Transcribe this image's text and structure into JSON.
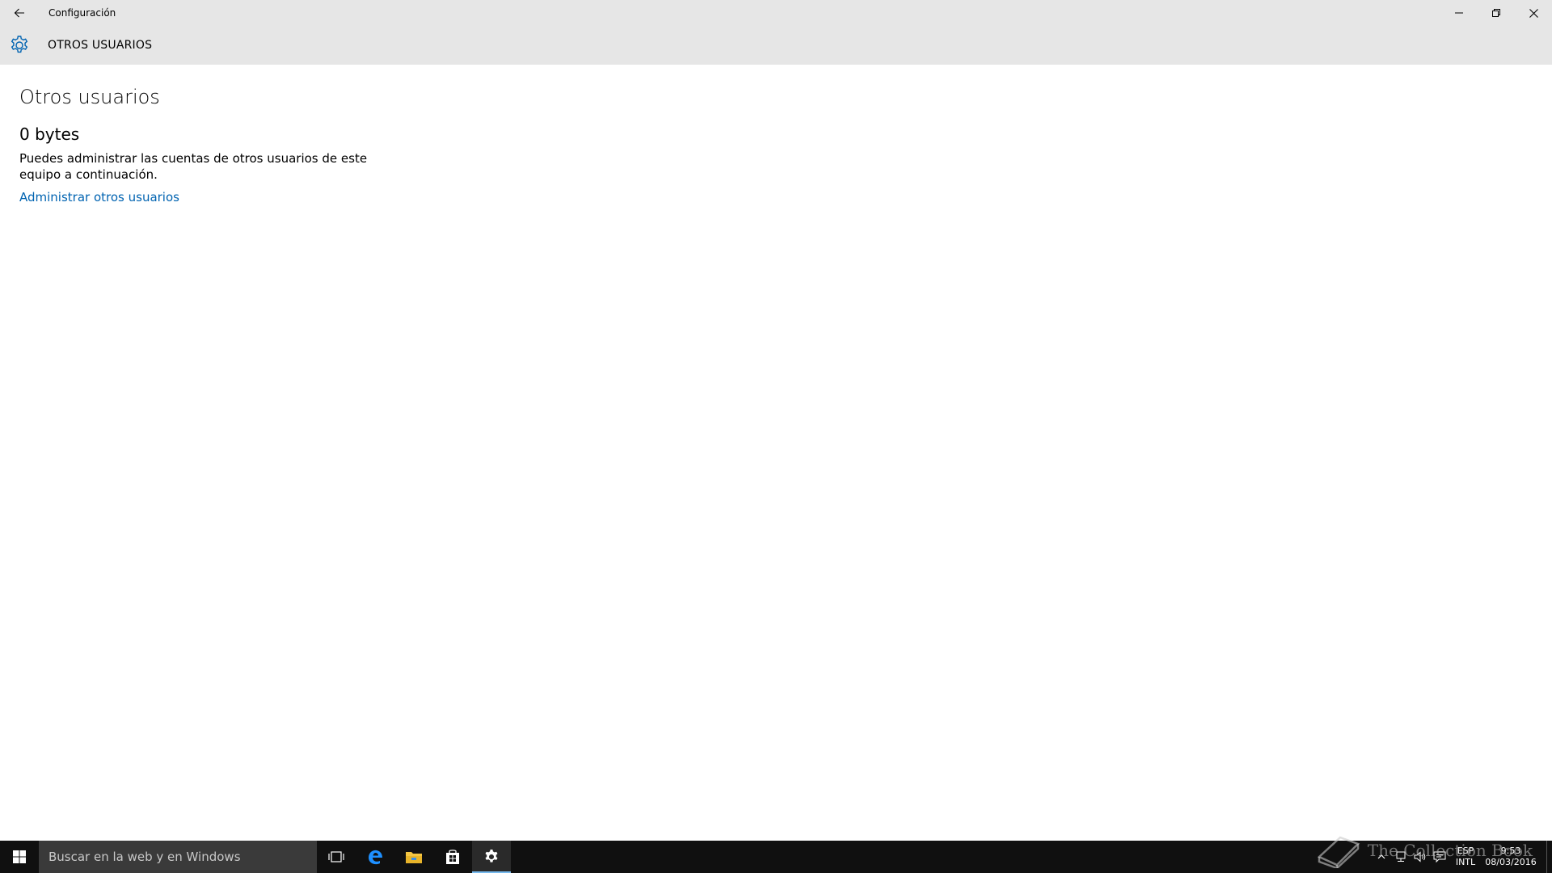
{
  "window": {
    "title": "Configuración"
  },
  "header": {
    "title": "OTROS USUARIOS",
    "icon": "gear-icon"
  },
  "content": {
    "page_title": "Otros usuarios",
    "size_value": "0 bytes",
    "description": "Puedes administrar las cuentas de otros usuarios de este equipo a continuación.",
    "link_label": "Administrar otros usuarios"
  },
  "taskbar": {
    "search_placeholder": "Buscar en la web y en Windows",
    "lang_top": "ESP",
    "lang_bottom": "INTL",
    "time": "9:53",
    "date": "08/03/2016"
  },
  "watermark": {
    "text": "The Collection Book"
  },
  "colors": {
    "accent": "#0063b1",
    "header_bg": "#e6e6e6",
    "taskbar_bg": "#101010"
  }
}
